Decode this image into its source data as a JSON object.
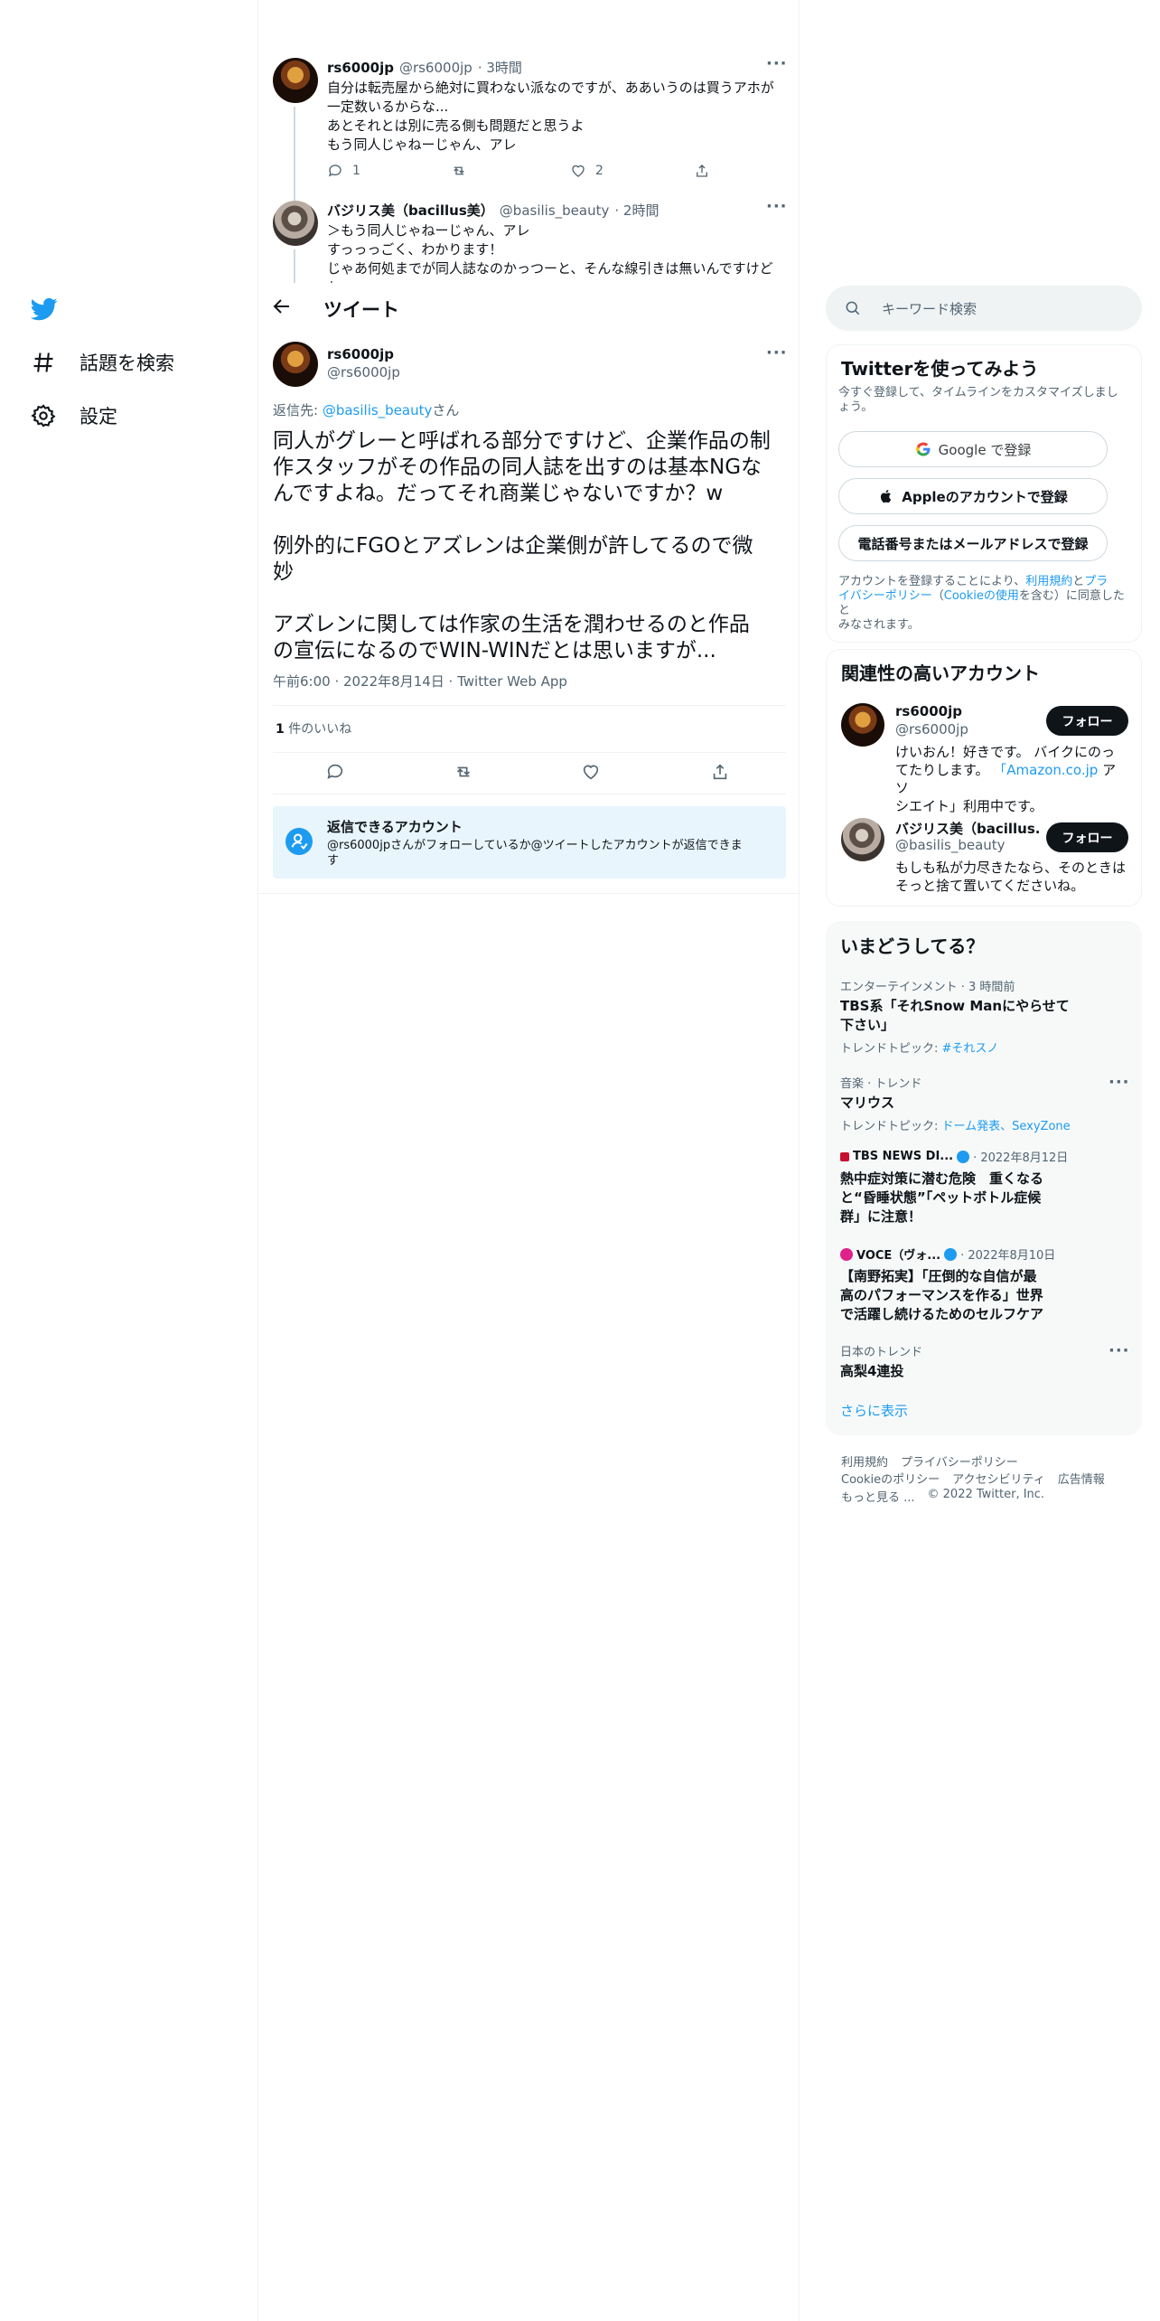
{
  "nav": {
    "items": [
      {
        "label": "話題を検索",
        "icon": "hashtag-icon"
      },
      {
        "label": "設定",
        "icon": "gear-icon"
      }
    ]
  },
  "thread": {
    "tweet1": {
      "name": "rs6000jp",
      "handle": "@rs6000jp",
      "time": "· 3時間",
      "lines": [
        "自分は転売屋から絶対に買わない派なのですが、ああいうのは買うアホが",
        "一定数いるからな...",
        "あとそれとは別に売る側も問題だと思うよ",
        "もう同人じゃねーじゃん、アレ"
      ],
      "reply_count": "1",
      "like_count": "2"
    },
    "tweet2": {
      "name": "バジリス美（bacillus美）",
      "handle": "@basilis_beauty",
      "time": "· 2時間",
      "lines": [
        "＞もう同人じゃねーじゃん、アレ",
        "すっっっごく、わかります！",
        "じゃあ何処までが同人誌なのかっつーと、そんな線引きは無いんですけど",
        "ね"
      ]
    }
  },
  "header": {
    "title": "ツイート"
  },
  "main_tweet": {
    "name": "rs6000jp",
    "handle": "@rs6000jp",
    "reply_prefix": "返信先: ",
    "reply_to": "@basilis_beauty",
    "reply_suffix": "さん",
    "p1": [
      "同人がグレーと呼ばれる部分ですけど、企業作品の制",
      "作スタッフがその作品の同人誌を出すのは基本NGな",
      "んですよね。だってそれ商業じゃないですか？w"
    ],
    "p2": [
      "例外的にFGOとアズレンは企業側が許してるので微",
      "妙"
    ],
    "p3": [
      "アズレンに関しては作家の生活を潤わせるのと作品",
      "の宣伝になるのでWIN-WINだとは思いますが..."
    ],
    "meta": "午前6:00 · 2022年8月14日 · Twitter Web App",
    "likes_count": "1",
    "likes_label": " 件のいいね"
  },
  "reply_notice": {
    "title": "返信できるアカウント",
    "text": "@rs6000jpさんがフォローしているか@ツイートしたアカウントが返信できま",
    "text2": "す"
  },
  "search": {
    "placeholder": "キーワード検索"
  },
  "signup": {
    "title": "Twitterを使ってみよう",
    "subtitle1": "今すぐ登録して、タイムラインをカスタマイズしまし",
    "subtitle2": "ょう。",
    "google": "Google で登録",
    "apple": "Appleのアカウントで登録",
    "phone": "電話番号またはメールアドレスで登録",
    "legal1a": "アカウントを登録することにより、",
    "legal1b": "利用規約",
    "legal1c": "と",
    "legal1d": "プラ",
    "legal2a": "イバシーポリシー",
    "legal2b": "（",
    "legal2c": "Cookieの使用",
    "legal2d": "を含む）に同意したと",
    "legal3": "みなされます。"
  },
  "related": {
    "title": "関連性の高いアカウント",
    "follow_label": "フォロー",
    "accounts": [
      {
        "name": "rs6000jp",
        "handle": "@rs6000jp",
        "bio1": "けいおん！好きです。 バイクにのっ",
        "bio2a": "てたりします。 ",
        "bio2b": "「Amazon.co.jp",
        "bio2c": " アソ",
        "bio3": "シエイト」利用中です。"
      },
      {
        "name": "バジリス美（bacillus...",
        "handle": "@basilis_beauty",
        "bio1": "もしも私が力尽きたなら、そのときは",
        "bio2": "そっと捨て置いてくださいね。"
      }
    ]
  },
  "trends": {
    "title": "いまどうしてる？",
    "items": [
      {
        "cat": "エンターテインメント · 3 時間前",
        "title1": "TBS系「それSnow Manにやらせて",
        "title2": "下さい」",
        "topic_label": "トレンドトピック: ",
        "topic": "#それスノ"
      },
      {
        "cat": "音楽 · トレンド",
        "title1": "マリウス",
        "topic_label": "トレンドトピック: ",
        "topic": "ドーム発表、SexyZone"
      },
      {
        "cat_source": "TBS NEWS DI...",
        "cat_date": " · 2022年8月12日",
        "title1": "熱中症対策に潜む危険　重くなる",
        "title2": "と“昏睡状態”「ペットボトル症候",
        "title3": "群」に注意！"
      },
      {
        "cat_source": "VOCE（ヴォ...",
        "cat_date": " · 2022年8月10日",
        "title1": "【南野拓実】「圧倒的な自信が最",
        "title2": "高のパフォーマンスを作る」世界",
        "title3": "で活躍し続けるためのセルフケア"
      },
      {
        "cat": "日本のトレンド",
        "title1": "高梨4連投"
      }
    ],
    "show_more": "さらに表示"
  },
  "footer": {
    "line1": [
      "利用規約",
      "プライバシーポリシー"
    ],
    "line2": [
      "Cookieのポリシー",
      "アクセシビリティ",
      "広告情報"
    ],
    "more": "もっと見る ...",
    "copyright": "© 2022 Twitter, Inc."
  },
  "colors": {
    "accent": "#1d9bf0",
    "text": "#0f1419",
    "muted": "#536471",
    "notice_bg": "#e8f5fd"
  }
}
